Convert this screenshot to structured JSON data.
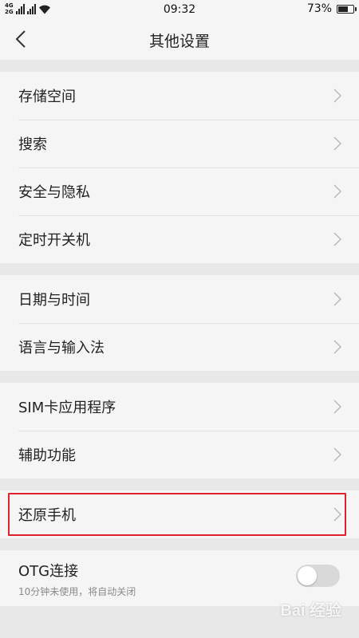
{
  "status_bar": {
    "network_top": "4G",
    "network_bottom": "2G",
    "time": "09:32",
    "battery_text": "73%",
    "battery_level": 0.73
  },
  "header": {
    "title": "其他设置"
  },
  "groups": [
    {
      "items": [
        {
          "label": "存储空间"
        },
        {
          "label": "搜索"
        },
        {
          "label": "安全与隐私"
        },
        {
          "label": "定时开关机"
        }
      ]
    },
    {
      "items": [
        {
          "label": "日期与时间"
        },
        {
          "label": "语言与输入法"
        }
      ]
    },
    {
      "items": [
        {
          "label": "SIM卡应用程序"
        },
        {
          "label": "辅助功能"
        }
      ]
    },
    {
      "items": [
        {
          "label": "还原手机"
        }
      ]
    }
  ],
  "otg": {
    "title": "OTG连接",
    "subtitle": "10分钟未使用，将自动关闭",
    "enabled": false
  },
  "watermark": "Bai 经验"
}
